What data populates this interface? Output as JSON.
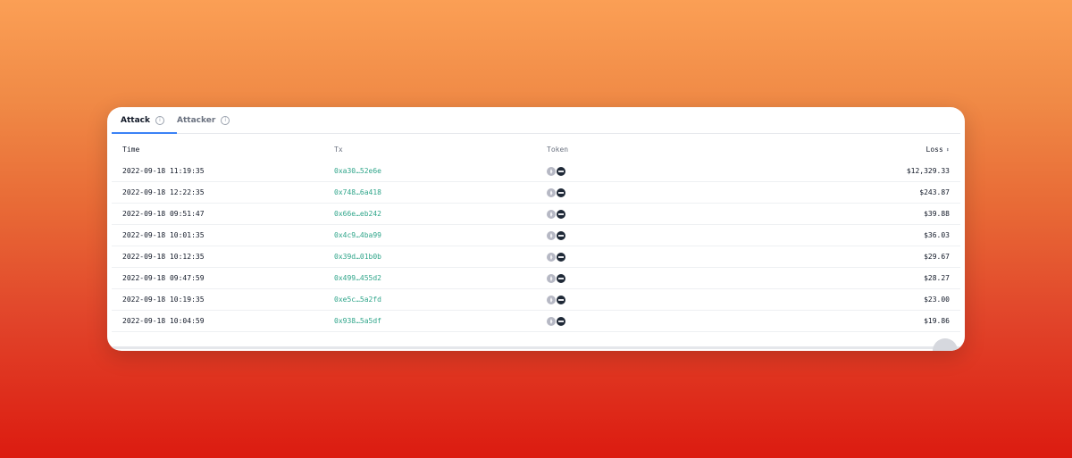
{
  "tabs": [
    {
      "label": "Attack",
      "active": true
    },
    {
      "label": "Attacker",
      "active": false
    }
  ],
  "table": {
    "headers": {
      "time": "Time",
      "tx": "Tx",
      "token": "Token",
      "loss": "Loss"
    },
    "rows": [
      {
        "time": "2022-09-18 11:19:35",
        "tx": "0xa30…52e6e",
        "loss": "$12,329.33"
      },
      {
        "time": "2022-09-18 12:22:35",
        "tx": "0x748…6a418",
        "loss": "$243.87"
      },
      {
        "time": "2022-09-18 09:51:47",
        "tx": "0x66e…eb242",
        "loss": "$39.88"
      },
      {
        "time": "2022-09-18 10:01:35",
        "tx": "0x4c9…4ba99",
        "loss": "$36.03"
      },
      {
        "time": "2022-09-18 10:12:35",
        "tx": "0x39d…01b0b",
        "loss": "$29.67"
      },
      {
        "time": "2022-09-18 09:47:59",
        "tx": "0x499…455d2",
        "loss": "$28.27"
      },
      {
        "time": "2022-09-18 10:19:35",
        "tx": "0xe5c…5a2fd",
        "loss": "$23.00"
      },
      {
        "time": "2022-09-18 10:04:59",
        "tx": "0x938…5a5df",
        "loss": "$19.86"
      }
    ]
  },
  "icons": {
    "info": "info-icon",
    "sort": "sort-icon",
    "token_primary": "eth-token-icon",
    "token_secondary": "token-icon"
  },
  "colors": {
    "accent": "#3b82f6",
    "tx_link": "#2fa58a",
    "background_top": "#fb9f55",
    "background_bottom": "#dc1b10"
  }
}
